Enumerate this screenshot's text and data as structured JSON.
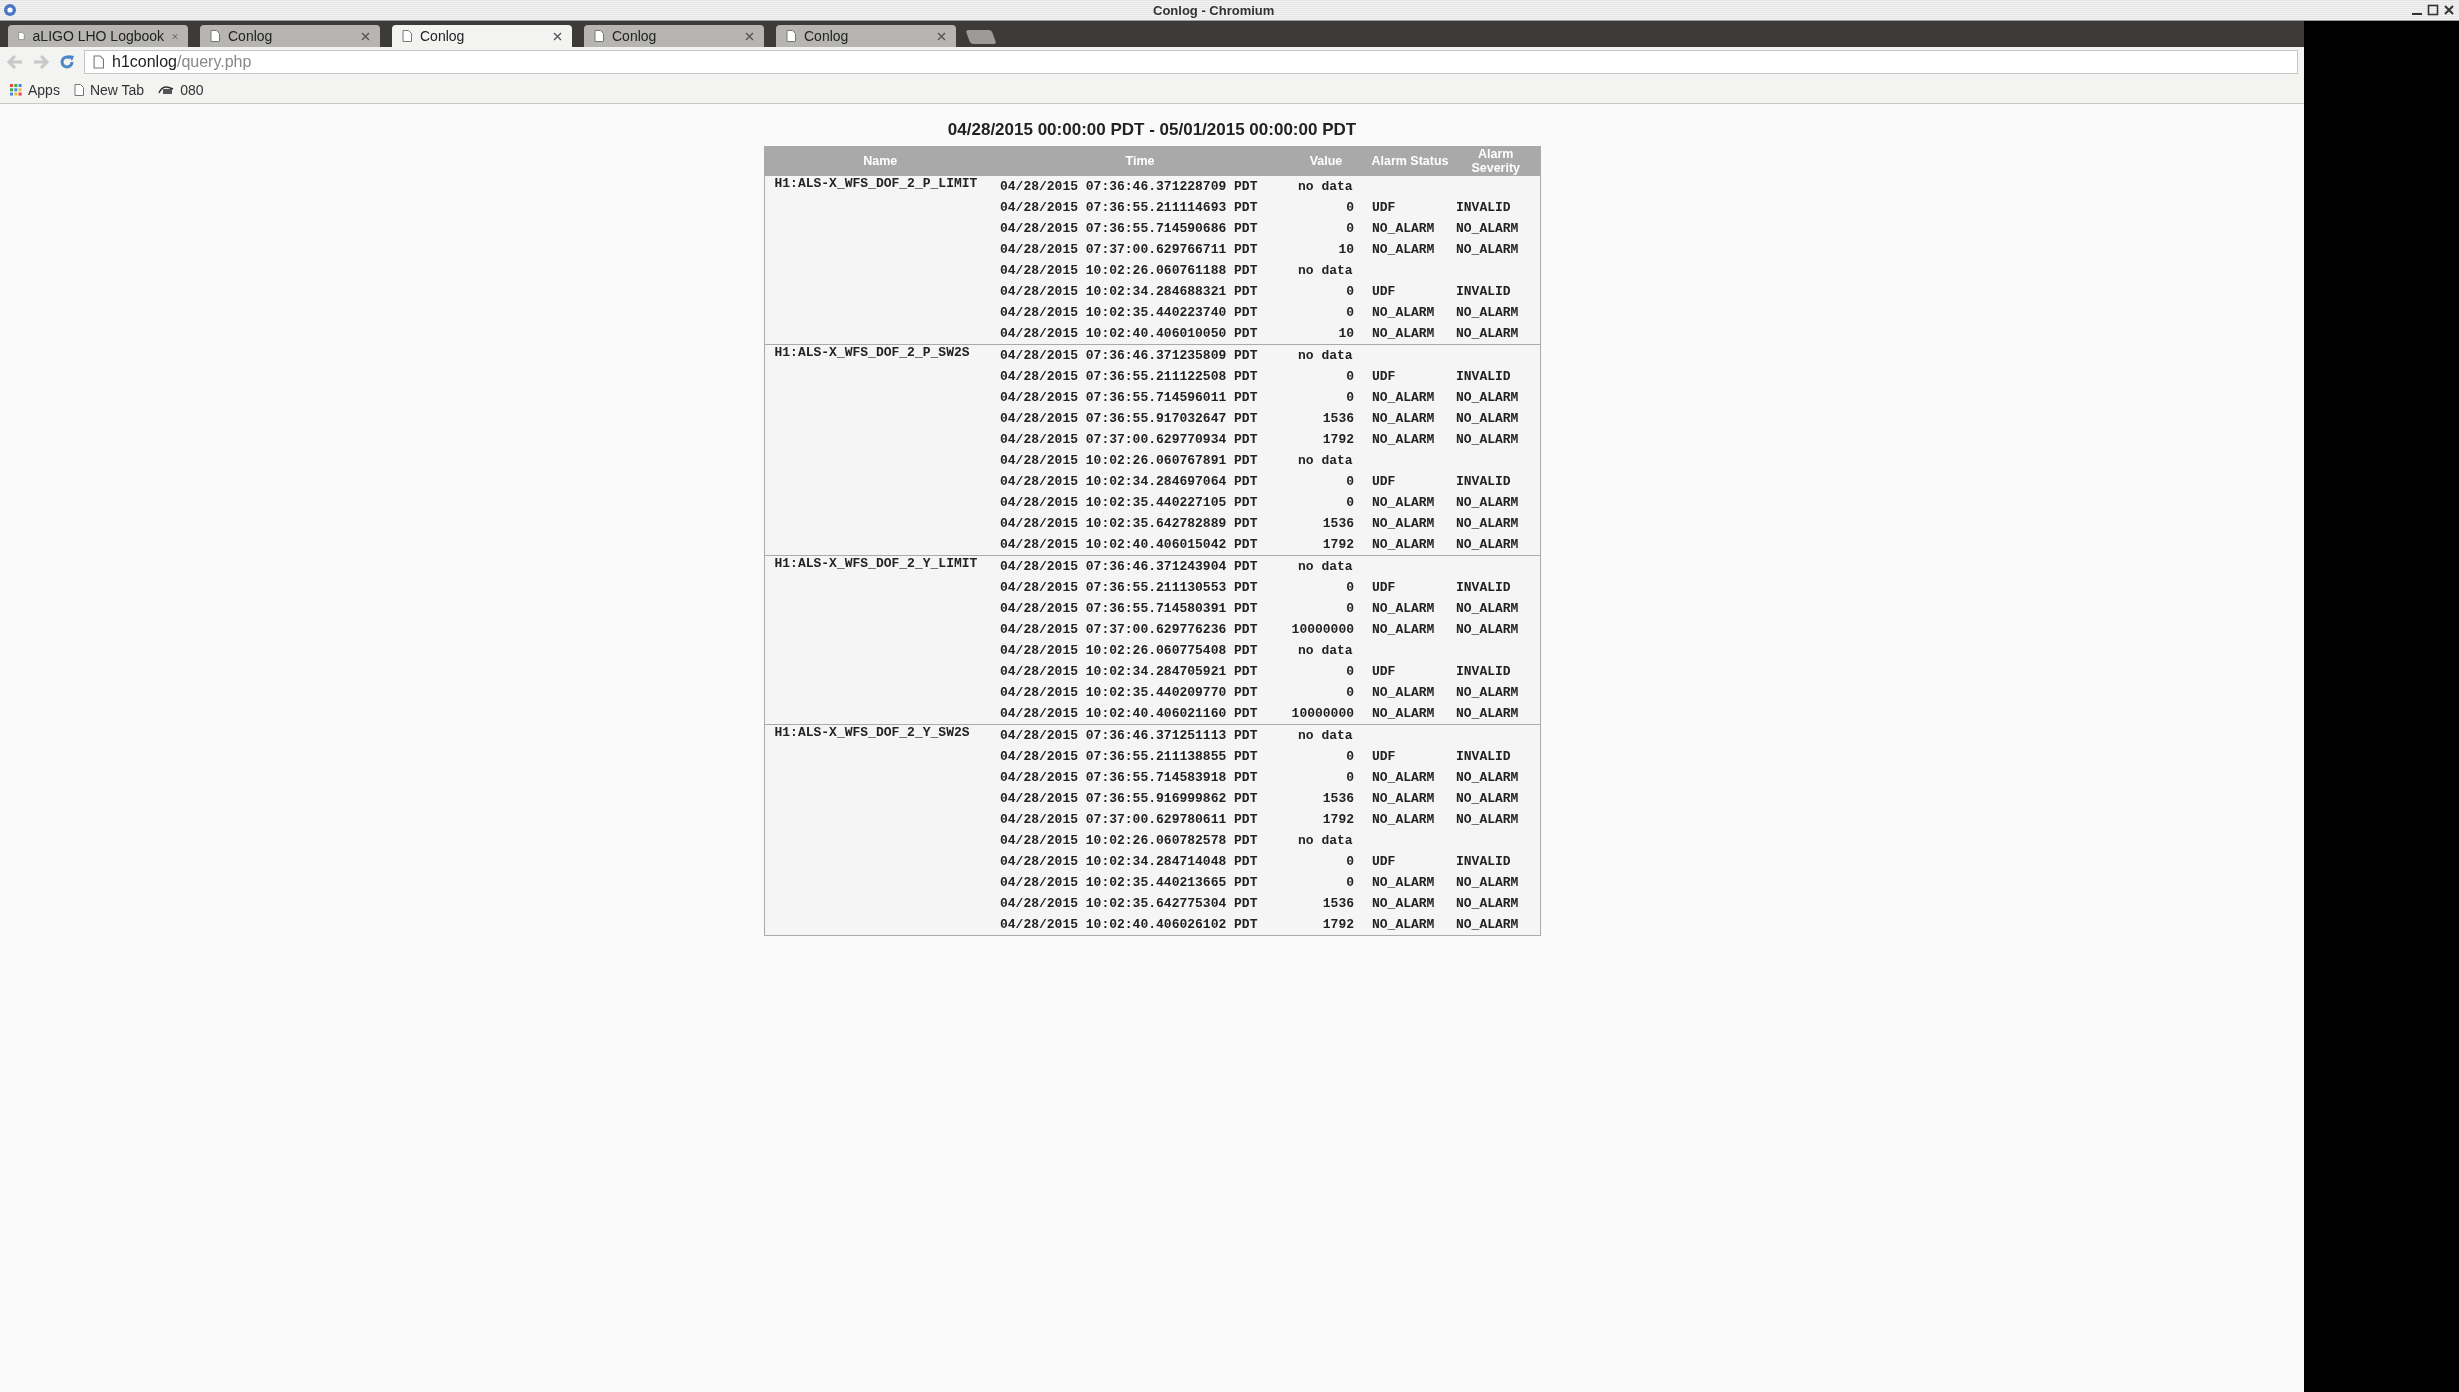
{
  "window": {
    "title": "Conlog - Chromium"
  },
  "tabs": [
    {
      "label": "aLIGO LHO Logbook",
      "selected": false
    },
    {
      "label": "Conlog",
      "selected": false
    },
    {
      "label": "Conlog",
      "selected": true
    },
    {
      "label": "Conlog",
      "selected": false
    },
    {
      "label": "Conlog",
      "selected": false
    }
  ],
  "address_bar": {
    "host": "h1conlog",
    "path": "/query.php"
  },
  "bookmarks": [
    {
      "label": "Apps",
      "kind": "apps"
    },
    {
      "label": "New Tab",
      "kind": "page"
    },
    {
      "label": "080",
      "kind": "logo"
    }
  ],
  "page": {
    "heading": "04/28/2015 00:00:00 PDT - 05/01/2015 00:00:00 PDT",
    "table": {
      "columns": [
        "Name",
        "Time",
        "Value",
        "Alarm Status",
        "Alarm Severity"
      ],
      "groups": [
        {
          "name": "H1:ALS-X_WFS_DOF_2_P_LIMIT",
          "rows": [
            {
              "time": "04/28/2015 07:36:46.371228709 PDT",
              "value": "no data"
            },
            {
              "time": "04/28/2015 07:36:55.211114693 PDT",
              "value": "0",
              "alarm_status": "UDF",
              "alarm_severity": "INVALID"
            },
            {
              "time": "04/28/2015 07:36:55.714590686 PDT",
              "value": "0",
              "alarm_status": "NO_ALARM",
              "alarm_severity": "NO_ALARM"
            },
            {
              "time": "04/28/2015 07:37:00.629766711 PDT",
              "value": "10",
              "alarm_status": "NO_ALARM",
              "alarm_severity": "NO_ALARM"
            },
            {
              "time": "04/28/2015 10:02:26.060761188 PDT",
              "value": "no data"
            },
            {
              "time": "04/28/2015 10:02:34.284688321 PDT",
              "value": "0",
              "alarm_status": "UDF",
              "alarm_severity": "INVALID"
            },
            {
              "time": "04/28/2015 10:02:35.440223740 PDT",
              "value": "0",
              "alarm_status": "NO_ALARM",
              "alarm_severity": "NO_ALARM"
            },
            {
              "time": "04/28/2015 10:02:40.406010050 PDT",
              "value": "10",
              "alarm_status": "NO_ALARM",
              "alarm_severity": "NO_ALARM"
            }
          ]
        },
        {
          "name": "H1:ALS-X_WFS_DOF_2_P_SW2S",
          "rows": [
            {
              "time": "04/28/2015 07:36:46.371235809 PDT",
              "value": "no data"
            },
            {
              "time": "04/28/2015 07:36:55.211122508 PDT",
              "value": "0",
              "alarm_status": "UDF",
              "alarm_severity": "INVALID"
            },
            {
              "time": "04/28/2015 07:36:55.714596011 PDT",
              "value": "0",
              "alarm_status": "NO_ALARM",
              "alarm_severity": "NO_ALARM"
            },
            {
              "time": "04/28/2015 07:36:55.917032647 PDT",
              "value": "1536",
              "alarm_status": "NO_ALARM",
              "alarm_severity": "NO_ALARM"
            },
            {
              "time": "04/28/2015 07:37:00.629770934 PDT",
              "value": "1792",
              "alarm_status": "NO_ALARM",
              "alarm_severity": "NO_ALARM"
            },
            {
              "time": "04/28/2015 10:02:26.060767891 PDT",
              "value": "no data"
            },
            {
              "time": "04/28/2015 10:02:34.284697064 PDT",
              "value": "0",
              "alarm_status": "UDF",
              "alarm_severity": "INVALID"
            },
            {
              "time": "04/28/2015 10:02:35.440227105 PDT",
              "value": "0",
              "alarm_status": "NO_ALARM",
              "alarm_severity": "NO_ALARM"
            },
            {
              "time": "04/28/2015 10:02:35.642782889 PDT",
              "value": "1536",
              "alarm_status": "NO_ALARM",
              "alarm_severity": "NO_ALARM"
            },
            {
              "time": "04/28/2015 10:02:40.406015042 PDT",
              "value": "1792",
              "alarm_status": "NO_ALARM",
              "alarm_severity": "NO_ALARM"
            }
          ]
        },
        {
          "name": "H1:ALS-X_WFS_DOF_2_Y_LIMIT",
          "rows": [
            {
              "time": "04/28/2015 07:36:46.371243904 PDT",
              "value": "no data"
            },
            {
              "time": "04/28/2015 07:36:55.211130553 PDT",
              "value": "0",
              "alarm_status": "UDF",
              "alarm_severity": "INVALID"
            },
            {
              "time": "04/28/2015 07:36:55.714580391 PDT",
              "value": "0",
              "alarm_status": "NO_ALARM",
              "alarm_severity": "NO_ALARM"
            },
            {
              "time": "04/28/2015 07:37:00.629776236 PDT",
              "value": "10000000",
              "alarm_status": "NO_ALARM",
              "alarm_severity": "NO_ALARM"
            },
            {
              "time": "04/28/2015 10:02:26.060775408 PDT",
              "value": "no data"
            },
            {
              "time": "04/28/2015 10:02:34.284705921 PDT",
              "value": "0",
              "alarm_status": "UDF",
              "alarm_severity": "INVALID"
            },
            {
              "time": "04/28/2015 10:02:35.440209770 PDT",
              "value": "0",
              "alarm_status": "NO_ALARM",
              "alarm_severity": "NO_ALARM"
            },
            {
              "time": "04/28/2015 10:02:40.406021160 PDT",
              "value": "10000000",
              "alarm_status": "NO_ALARM",
              "alarm_severity": "NO_ALARM"
            }
          ]
        },
        {
          "name": "H1:ALS-X_WFS_DOF_2_Y_SW2S",
          "rows": [
            {
              "time": "04/28/2015 07:36:46.371251113 PDT",
              "value": "no data"
            },
            {
              "time": "04/28/2015 07:36:55.211138855 PDT",
              "value": "0",
              "alarm_status": "UDF",
              "alarm_severity": "INVALID"
            },
            {
              "time": "04/28/2015 07:36:55.714583918 PDT",
              "value": "0",
              "alarm_status": "NO_ALARM",
              "alarm_severity": "NO_ALARM"
            },
            {
              "time": "04/28/2015 07:36:55.916999862 PDT",
              "value": "1536",
              "alarm_status": "NO_ALARM",
              "alarm_severity": "NO_ALARM"
            },
            {
              "time": "04/28/2015 07:37:00.629780611 PDT",
              "value": "1792",
              "alarm_status": "NO_ALARM",
              "alarm_severity": "NO_ALARM"
            },
            {
              "time": "04/28/2015 10:02:26.060782578 PDT",
              "value": "no data"
            },
            {
              "time": "04/28/2015 10:02:34.284714048 PDT",
              "value": "0",
              "alarm_status": "UDF",
              "alarm_severity": "INVALID"
            },
            {
              "time": "04/28/2015 10:02:35.440213665 PDT",
              "value": "0",
              "alarm_status": "NO_ALARM",
              "alarm_severity": "NO_ALARM"
            },
            {
              "time": "04/28/2015 10:02:35.642775304 PDT",
              "value": "1536",
              "alarm_status": "NO_ALARM",
              "alarm_severity": "NO_ALARM"
            },
            {
              "time": "04/28/2015 10:02:40.406026102 PDT",
              "value": "1792",
              "alarm_status": "NO_ALARM",
              "alarm_severity": "NO_ALARM"
            }
          ]
        }
      ]
    }
  }
}
